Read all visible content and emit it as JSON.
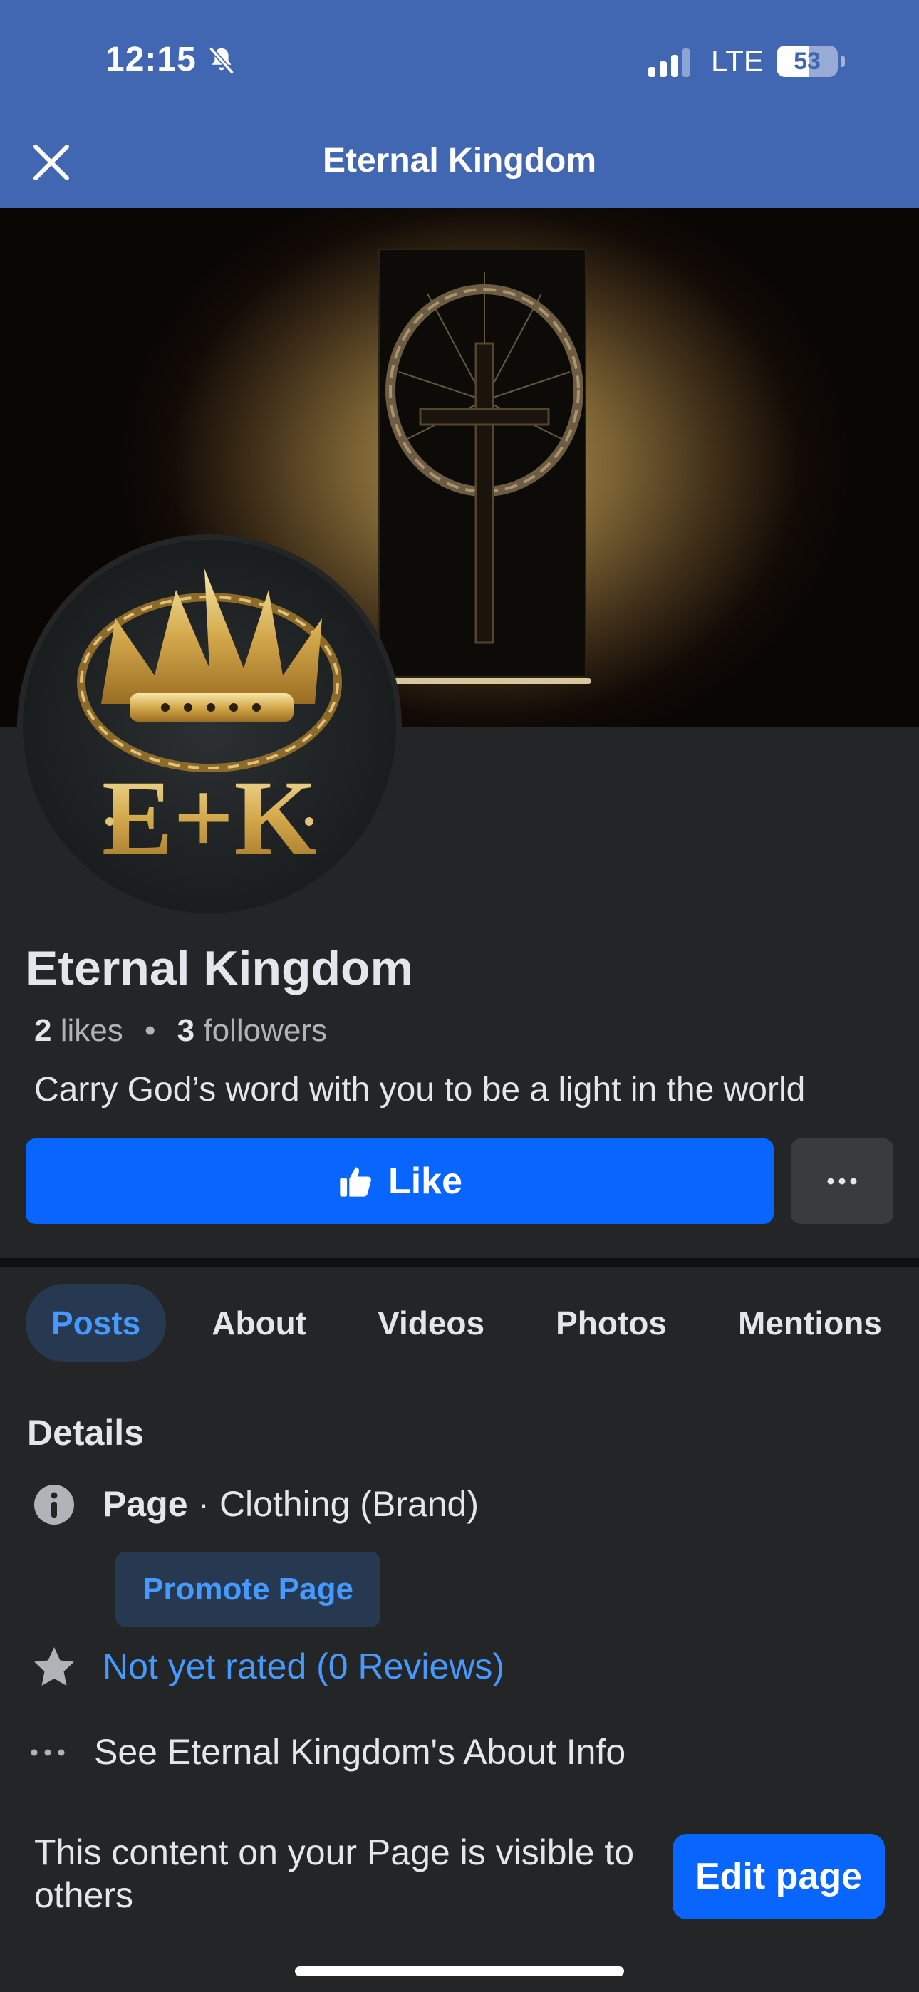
{
  "status_bar": {
    "time": "12:15",
    "network": "LTE",
    "battery": "53",
    "battery_level": 0.53
  },
  "nav": {
    "title": "Eternal Kingdom",
    "close_icon": "close-icon"
  },
  "profile": {
    "logo_text": "E+K",
    "name": "Eternal Kingdom",
    "likes_count": "2",
    "likes_label": "likes",
    "followers_count": "3",
    "followers_label": "followers",
    "tagline": "Carry God’s word with you to be a light in the world"
  },
  "actions": {
    "like_label": "Like",
    "more_icon": "more-dots-icon"
  },
  "tabs": [
    {
      "label": "Posts",
      "active": true
    },
    {
      "label": "About",
      "active": false
    },
    {
      "label": "Videos",
      "active": false
    },
    {
      "label": "Photos",
      "active": false
    },
    {
      "label": "Mentions",
      "active": false
    }
  ],
  "details": {
    "title": "Details",
    "page_type_bold": "Page",
    "page_type_rest": " · Clothing (Brand)",
    "promote_label": "Promote Page",
    "rating": "Not yet rated (0 Reviews)",
    "about_link": "See Eternal Kingdom's About Info"
  },
  "footer": {
    "visibility_text": "This content on your Page is visible to others",
    "edit_label": "Edit page"
  },
  "colors": {
    "header_blue": "#4267b2",
    "primary_button": "#0866ff",
    "link_blue": "#4599ff",
    "background": "#242526"
  }
}
